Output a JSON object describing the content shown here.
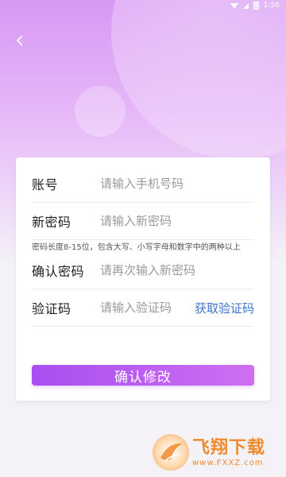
{
  "status_bar": {
    "time": "1:56"
  },
  "icons": {
    "back": "chevron-left-icon",
    "wifi": "wifi-icon",
    "signal": "signal-icon",
    "battery": "battery-icon"
  },
  "colors": {
    "accent_start": "#a74ff0",
    "accent_end": "#cf6ff2",
    "link": "#3f74c9",
    "header_gradient_top": "#d898f4"
  },
  "form": {
    "account": {
      "label": "账号",
      "placeholder": "请输入手机号码"
    },
    "new_password": {
      "label": "新密码",
      "placeholder": "请输入新密码"
    },
    "password_hint": "密码长度8-15位，包含大写、小写字母和数字中的两种以上",
    "confirm_password": {
      "label": "确认密码",
      "placeholder": "请再次输入新密码"
    },
    "code": {
      "label": "验证码",
      "placeholder": "请输入验证码",
      "get_code_label": "获取验证码"
    },
    "submit_label": "确认修改"
  },
  "watermark": {
    "name": "飞翔下载",
    "url": "www.FXXZ.com"
  }
}
